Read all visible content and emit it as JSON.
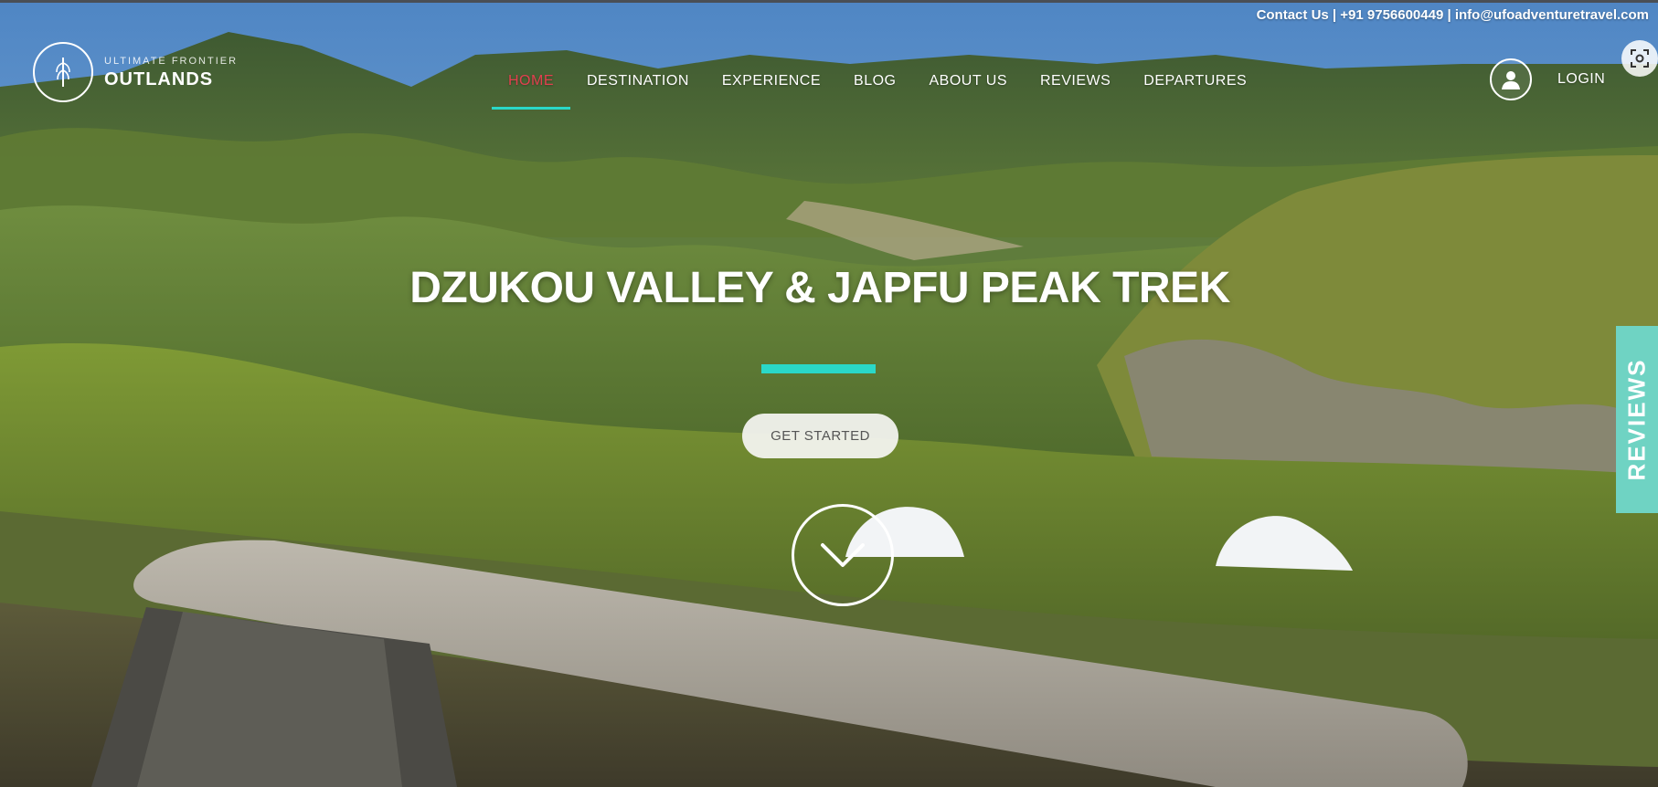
{
  "top_bar": {
    "contact_text": "Contact Us | +91 9756600449 | info@ufoadventuretravel.com"
  },
  "logo": {
    "tagline": "ULTIMATE FRONTIER",
    "name": "OUTLANDS"
  },
  "nav": {
    "items": [
      {
        "label": "HOME",
        "active": true
      },
      {
        "label": "DESTINATION",
        "active": false
      },
      {
        "label": "EXPERIENCE",
        "active": false
      },
      {
        "label": "BLOG",
        "active": false
      },
      {
        "label": "ABOUT US",
        "active": false
      },
      {
        "label": "REVIEWS",
        "active": false
      },
      {
        "label": "DEPARTURES",
        "active": false
      }
    ]
  },
  "account": {
    "login_label": "LOGIN",
    "avatar_icon": "user-icon"
  },
  "hero": {
    "title": "DZUKOU VALLEY & JAPFU PEAK TREK",
    "cta_label": "GET STARTED",
    "scroll_icon": "chevron-down-icon"
  },
  "side_tab": {
    "label": "REVIEWS"
  },
  "colors": {
    "accent": "#2ad8c8",
    "nav_active": "#e2404f",
    "side_tab": "#6fd3c3"
  }
}
